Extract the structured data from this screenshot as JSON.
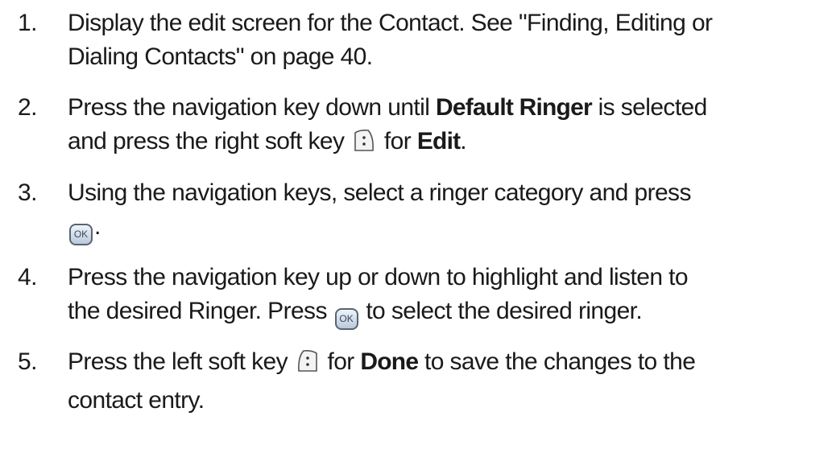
{
  "steps": [
    {
      "number": "1.",
      "line1": "Display the edit screen for the Contact. See \"Finding, Editing or",
      "line2": "Dialing Contacts\" on page 40."
    },
    {
      "number": "2.",
      "a": "Press the navigation key down until ",
      "b": "Default Ringer",
      "c": " is selected",
      "d": "and press the right soft key ",
      "e": " for ",
      "f": "Edit",
      "g": "."
    },
    {
      "number": "3.",
      "line1": "Using the navigation keys, select a ringer category and press",
      "after": "."
    },
    {
      "number": "4.",
      "line1": "Press the navigation key up or down to highlight and listen to",
      "a": "the desired Ringer. Press ",
      "b": " to select the desired ringer."
    },
    {
      "number": "5.",
      "a": "Press the left soft key ",
      "b": " for ",
      "c": "Done",
      "d": " to save the changes to the",
      "line2": "contact entry."
    }
  ],
  "keys": {
    "ok_label": "OK",
    "right_soft_key": "right-soft-key-icon",
    "left_soft_key": "left-soft-key-icon"
  }
}
